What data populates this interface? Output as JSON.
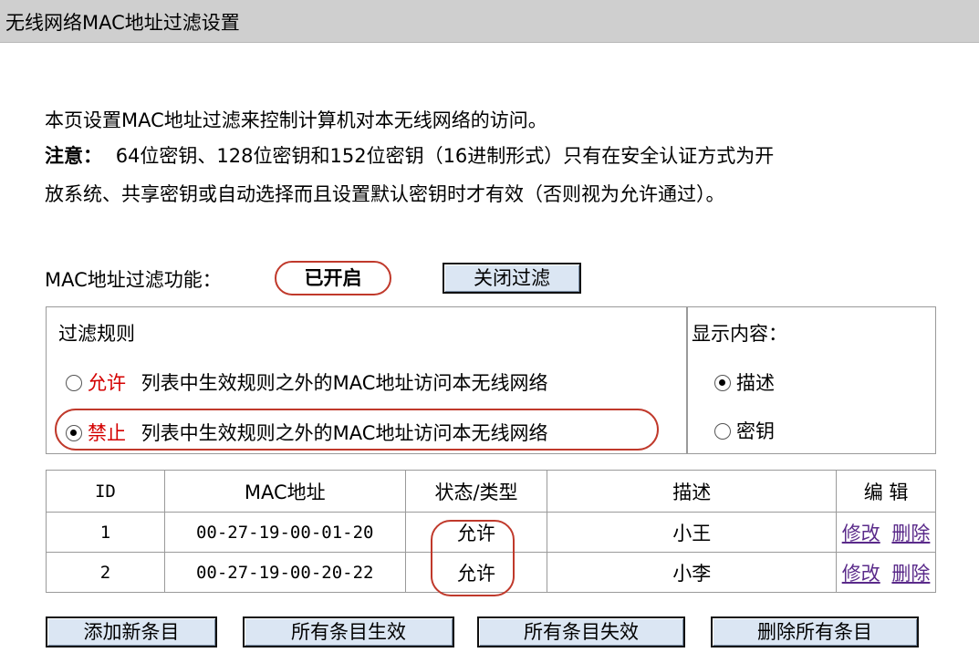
{
  "window": {
    "title": "无线网络MAC地址过滤设置"
  },
  "intro": "本页设置MAC地址过滤来控制计算机对本无线网络的访问。",
  "note": {
    "label": "注意：",
    "line1": "64位密钥、128位密钥和152位密钥（16进制形式）只有在安全认证方式为开",
    "line2": "放系统、共享密钥或自动选择而且设置默认密钥时才有效（否则视为允许通过）。"
  },
  "filter": {
    "label": "MAC地址过滤功能：",
    "status": "已开启",
    "toggle_button": "关闭过滤"
  },
  "rules": {
    "title": "过滤规则",
    "allow_keyword": "允许",
    "allow_text": "列表中生效规则之外的MAC地址访问本无线网络",
    "deny_keyword": "禁止",
    "deny_text": "列表中生效规则之外的MAC地址访问本无线网络",
    "selected": "deny"
  },
  "display": {
    "title": "显示内容：",
    "option_desc": "描述",
    "option_key": "密钥",
    "selected": "desc"
  },
  "table": {
    "headers": {
      "id": "ID",
      "mac": "MAC地址",
      "status": "状态/类型",
      "desc": "描述",
      "edit": "编 辑"
    },
    "rows": [
      {
        "id": "1",
        "mac": "00-27-19-00-01-20",
        "status": "允许",
        "desc": "小王",
        "modify": "修改",
        "delete": "删除"
      },
      {
        "id": "2",
        "mac": "00-27-19-00-20-22",
        "status": "允许",
        "desc": "小李",
        "modify": "修改",
        "delete": "删除"
      }
    ]
  },
  "actions": {
    "add": "添加新条目",
    "enable_all": "所有条目生效",
    "disable_all": "所有条目失效",
    "delete_all": "删除所有条目"
  }
}
